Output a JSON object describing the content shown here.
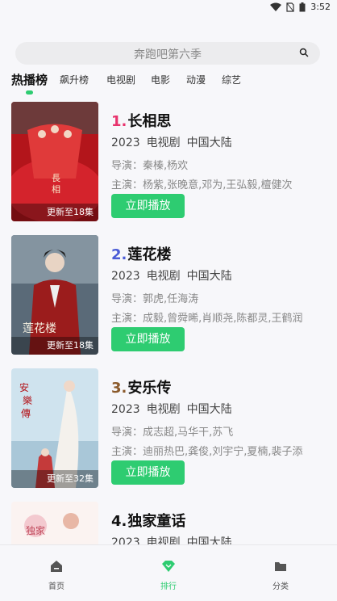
{
  "status_bar": {
    "time": "3:52"
  },
  "search": {
    "placeholder": "奔跑吧第六季"
  },
  "tabs": [
    {
      "label": "热播榜",
      "active": true
    },
    {
      "label": "飙升榜"
    },
    {
      "label": "电视剧"
    },
    {
      "label": "电影"
    },
    {
      "label": "动漫"
    },
    {
      "label": "综艺"
    }
  ],
  "items": [
    {
      "rank": "1.",
      "rank_color": "#e8336d",
      "title": "长相思",
      "year": "2023",
      "type": "电视剧",
      "region": "中国大陆",
      "director": "导演：秦榛,杨欢",
      "cast": "主演：杨紫,张晚意,邓为,王弘毅,檀健次",
      "episode": "更新至18集",
      "play_label": "立即播放"
    },
    {
      "rank": "2.",
      "rank_color": "#4a5bd6",
      "title": "莲花楼",
      "year": "2023",
      "type": "电视剧",
      "region": "中国大陆",
      "director": "导演：郭虎,任海涛",
      "cast": "主演：成毅,曾舜晞,肖顺尧,陈都灵,王鹤润",
      "episode": "更新至18集",
      "play_label": "立即播放"
    },
    {
      "rank": "3.",
      "rank_color": "#8b5a2b",
      "title": "安乐传",
      "year": "2023",
      "type": "电视剧",
      "region": "中国大陆",
      "director": "导演：成志超,马华干,苏飞",
      "cast": "主演：迪丽热巴,龚俊,刘宇宁,夏楠,裴子添",
      "episode": "更新至32集",
      "play_label": "立即播放"
    },
    {
      "rank": "4.",
      "rank_color": "#111111",
      "title": "独家童话",
      "year": "2023",
      "type": "电视剧",
      "region": "中国大陆",
      "director": "",
      "cast": "",
      "episode": "",
      "play_label": ""
    }
  ],
  "bottom_nav": [
    {
      "label": "首页",
      "icon": "home-icon"
    },
    {
      "label": "排行",
      "icon": "diamond-icon",
      "active": true
    },
    {
      "label": "分类",
      "icon": "folder-icon"
    }
  ],
  "colors": {
    "accent": "#2ecc71"
  }
}
